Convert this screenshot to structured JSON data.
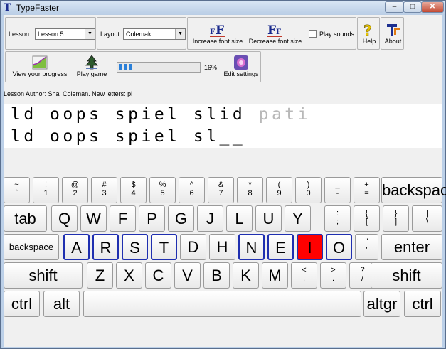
{
  "window": {
    "title": "TypeFaster",
    "app_icon": "T",
    "min_glyph": "–",
    "max_glyph": "□",
    "close_glyph": "✕"
  },
  "toolbar": {
    "lesson_label": "Lesson:",
    "lesson_value": "Lesson 5",
    "layout_label": "Layout:",
    "layout_value": "Colemak",
    "increase_font": "Increase font size",
    "decrease_font": "Decrease font size",
    "play_sounds": "Play sounds",
    "help": "Help",
    "about": "About",
    "view_progress": "View your progress",
    "play_game": "Play game",
    "progress_pct": "16%",
    "progress_value": 0.16,
    "edit_settings": "Edit settings"
  },
  "author_line": "Lesson Author: Shai Coleman. New letters: pl",
  "text": {
    "target_typed_part": "ld oops spiel slid ",
    "target_upcoming_part": "pati",
    "typed": "ld oops spiel sl__"
  },
  "keyboard": {
    "row1": [
      {
        "t": "~",
        "b": "`"
      },
      {
        "t": "!",
        "b": "1"
      },
      {
        "t": "@",
        "b": "2"
      },
      {
        "t": "#",
        "b": "3"
      },
      {
        "t": "$",
        "b": "4"
      },
      {
        "t": "%",
        "b": "5"
      },
      {
        "t": "^",
        "b": "6"
      },
      {
        "t": "&",
        "b": "7"
      },
      {
        "t": "*",
        "b": "8"
      },
      {
        "t": "(",
        "b": "9"
      },
      {
        "t": ")",
        "b": "0"
      },
      {
        "t": "_",
        "b": "-"
      },
      {
        "t": "+",
        "b": "="
      }
    ],
    "backspace": "backspace",
    "tab": "tab",
    "row2": [
      "Q",
      "W",
      "F",
      "P",
      "G",
      "J",
      "L",
      "U",
      "Y"
    ],
    "row2_sym": [
      {
        "t": ":",
        "b": ";"
      },
      {
        "t": "{",
        "b": "["
      },
      {
        "t": "}",
        "b": "]"
      },
      {
        "t": "|",
        "b": "\\"
      }
    ],
    "caps": "backspace",
    "row3": [
      "A",
      "R",
      "S",
      "T",
      "D",
      "H",
      "N",
      "E",
      "I",
      "O"
    ],
    "row3_sym": {
      "t": "\"",
      "b": "'"
    },
    "enter": "enter",
    "shift_left": "shift",
    "row4": [
      "Z",
      "X",
      "C",
      "V",
      "B",
      "K",
      "M"
    ],
    "row4_sym": [
      {
        "t": "<",
        "b": ","
      },
      {
        "t": ">",
        "b": "."
      },
      {
        "t": "?",
        "b": "/"
      }
    ],
    "shift_right": "shift",
    "ctrl_left": "ctrl",
    "alt": "alt",
    "space": "",
    "altgr": "altgr",
    "ctrl_right": "ctrl"
  },
  "colors": {
    "highlight": "#ff0000",
    "home_border": "#1f2fb0",
    "progress": "#2b80d8"
  }
}
